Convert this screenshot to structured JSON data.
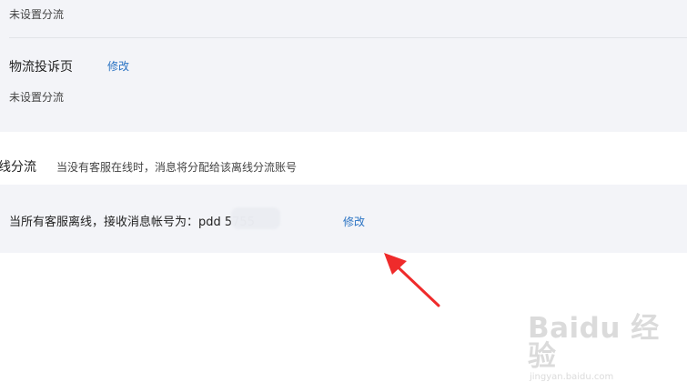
{
  "sections": {
    "top_status": "未设置分流",
    "logistics": {
      "title": "物流投诉页",
      "edit": "修改",
      "status": "未设置分流"
    },
    "offline": {
      "title": "线分流",
      "description": "当没有客服在线时，消息将分配给该离线分流账号",
      "account_text": "当所有客服离线，接收消息帐号为：pdd         5755",
      "edit": "修改"
    }
  },
  "watermark": {
    "brand": "Baidu 经验",
    "domain": "jingyan.baidu.com"
  },
  "colors": {
    "panel": "#f3f4f8",
    "link": "#2a73c3",
    "arrow": "#ef2b2b"
  }
}
